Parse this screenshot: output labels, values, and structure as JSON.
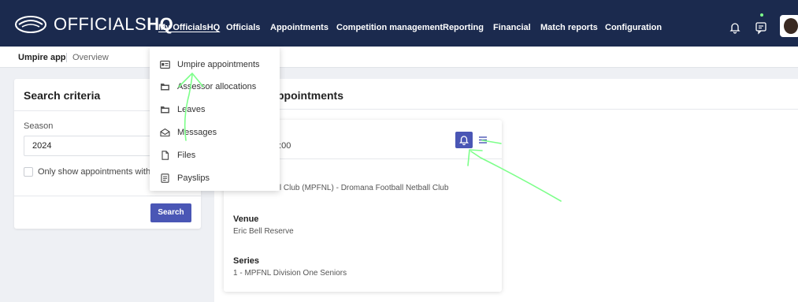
{
  "brand": {
    "light": "OFFICIALS",
    "bold": "HQ"
  },
  "nav": {
    "items": [
      "My OfficialsHQ",
      "Officials",
      "Appointments",
      "Competition management",
      "Reporting",
      "Financial",
      "Match reports",
      "Configuration"
    ],
    "active_index": 0
  },
  "breadcrumb": {
    "app": "Umpire app",
    "page": "Overview"
  },
  "dropdown": {
    "items": [
      {
        "label": "Umpire appointments",
        "icon": "id-card-icon"
      },
      {
        "label": "Assessor allocations",
        "icon": "folder-icon"
      },
      {
        "label": "Leaves",
        "icon": "folder-icon"
      },
      {
        "label": "Messages",
        "icon": "envelope-icon"
      },
      {
        "label": "Files",
        "icon": "file-icon"
      },
      {
        "label": "Payslips",
        "icon": "payslip-icon"
      }
    ]
  },
  "search": {
    "title": "Search criteria",
    "season_label": "Season",
    "season_value": "2024",
    "checkbox_label": "Only show appointments with documents",
    "button": "Search"
  },
  "appointments": {
    "title": "ppointments",
    "card": {
      "time": "0:00",
      "match": "Netball Club (MPFNL) - Dromana Football Netball Club",
      "venue_label": "Venue",
      "venue": "Eric Bell Reserve",
      "series_label": "Series",
      "series": "1 - MPFNL Division One Seniors"
    }
  },
  "colors": {
    "nav_bg": "#1b2a4e",
    "accent": "#4a56b5",
    "annotation": "#7dff8a"
  }
}
